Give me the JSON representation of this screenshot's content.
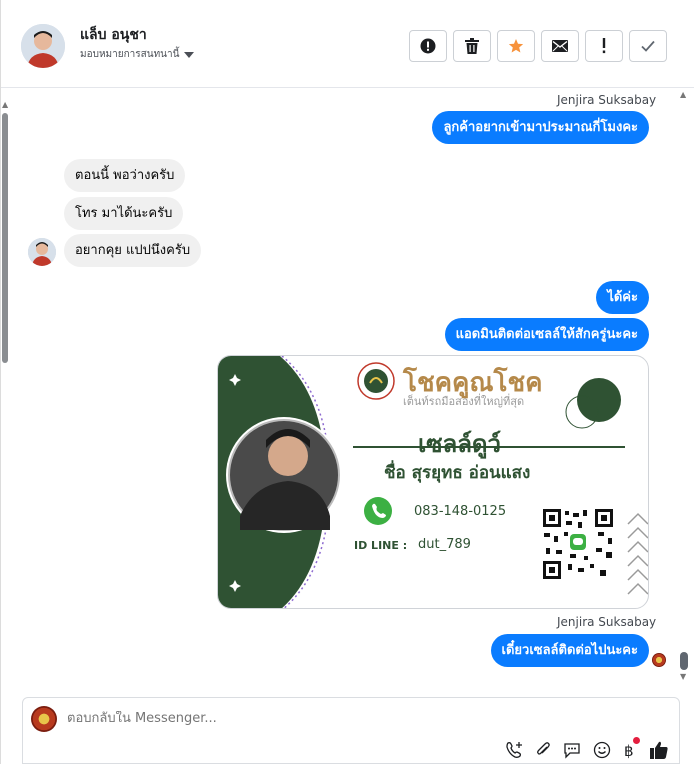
{
  "header": {
    "contact_name": "แล็บ อนุชา",
    "assign_label": "มอบหมายการสนทนานี้",
    "toolbar": [
      {
        "name": "mark-spam-button",
        "icon": "alert-circle-icon"
      },
      {
        "name": "delete-button",
        "icon": "trash-icon"
      },
      {
        "name": "star-button",
        "icon": "star-icon"
      },
      {
        "name": "mark-unread-button",
        "icon": "envelope-icon"
      },
      {
        "name": "follow-up-button",
        "icon": "exclamation-icon"
      },
      {
        "name": "mark-done-button",
        "icon": "check-icon"
      }
    ]
  },
  "messages": {
    "sender_label_1": "Jenjira Suksabay",
    "out_1": "ลูกค้าอยากเข้ามาประมาณกี่โมงคะ",
    "in_1": "ตอนนี้ พอว่างครับ",
    "in_2": "โทร มาได้นะครับ",
    "in_3": "อยากคุย แปปนึงครับ",
    "out_2": "ได้ค่ะ",
    "out_3": "แอดมินติดต่อเซลล์ให้สักครู่นะคะ",
    "sender_label_2": "Jenjira Suksabay",
    "out_4": "เดี๋ยวเซลล์ติดต่อไปนะคะ"
  },
  "card": {
    "brand": "โชคคูณโชค",
    "tagline": "เต็นท์รถมือสองที่ใหญ่ที่สุด",
    "role": "เซลล์ดูว์",
    "full_name": "ชื่อ สุรยุทธ อ่อนแสง",
    "phone": "083-148-0125",
    "id_label": "ID LINE :",
    "id_value": "dut_789",
    "accent_color": "#2f5233",
    "gold_color": "#b5894a"
  },
  "composer": {
    "placeholder": "ตอบกลับใน Messenger..."
  },
  "colors": {
    "outgoing_bubble": "#0a7cff",
    "incoming_bubble": "#f0f0f0",
    "star": "#f7923b"
  }
}
